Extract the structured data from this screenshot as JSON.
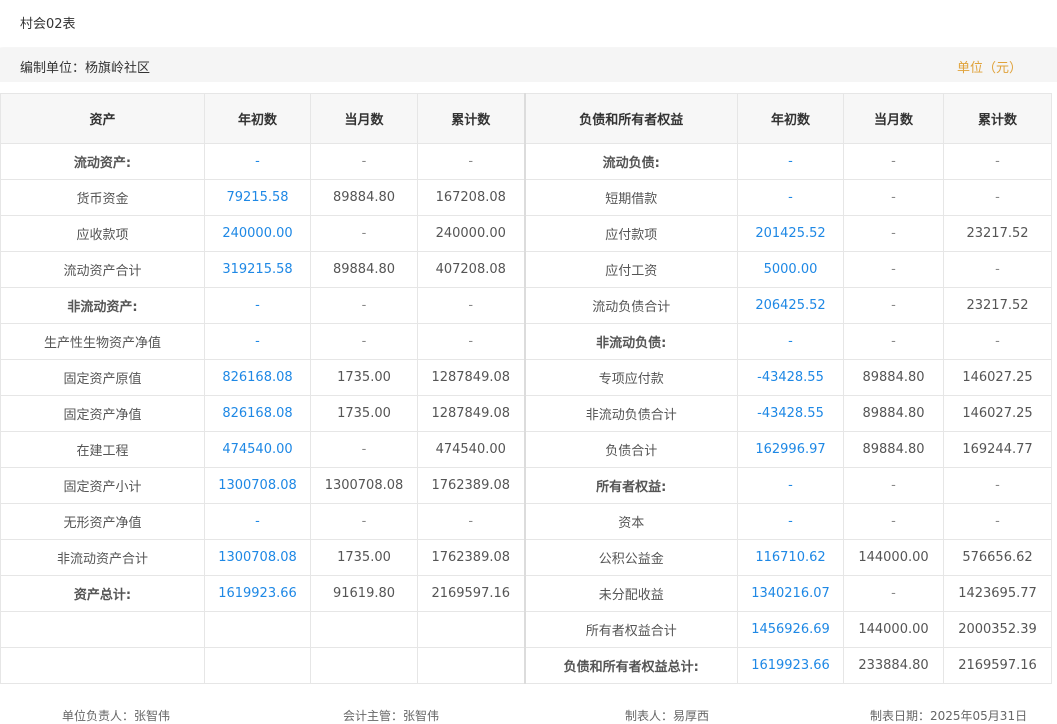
{
  "header": {
    "form_code": "村会02表"
  },
  "meta": {
    "org": "编制单位：杨旗岭社区",
    "unit": "单位（元）"
  },
  "columns": {
    "left": [
      "资产",
      "年初数",
      "当月数",
      "累计数"
    ],
    "right": [
      "负债和所有者权益",
      "年初数",
      "当月数",
      "累计数"
    ]
  },
  "rows": [
    {
      "l": [
        "流动资产:",
        "-",
        "-",
        "-"
      ],
      "r": [
        "流动负债:",
        "-",
        "-",
        "-"
      ],
      "lsub": true,
      "rsub": true
    },
    {
      "l": [
        "货币资金",
        "79215.58",
        "89884.80",
        "167208.08"
      ],
      "r": [
        "短期借款",
        "-",
        "-",
        "-"
      ]
    },
    {
      "l": [
        "应收款项",
        "240000.00",
        "-",
        "240000.00"
      ],
      "r": [
        "应付款项",
        "201425.52",
        "-",
        "23217.52"
      ]
    },
    {
      "l": [
        "流动资产合计",
        "319215.58",
        "89884.80",
        "407208.08"
      ],
      "r": [
        "应付工资",
        "5000.00",
        "-",
        "-"
      ]
    },
    {
      "l": [
        "非流动资产:",
        "-",
        "-",
        "-"
      ],
      "r": [
        "流动负债合计",
        "206425.52",
        "-",
        "23217.52"
      ],
      "lsub": true
    },
    {
      "l": [
        "生产性生物资产净值",
        "-",
        "-",
        "-"
      ],
      "r": [
        "非流动负债:",
        "-",
        "-",
        "-"
      ],
      "rsub": true
    },
    {
      "l": [
        "固定资产原值",
        "826168.08",
        "1735.00",
        "1287849.08"
      ],
      "r": [
        "专项应付款",
        "-43428.55",
        "89884.80",
        "146027.25"
      ]
    },
    {
      "l": [
        "固定资产净值",
        "826168.08",
        "1735.00",
        "1287849.08"
      ],
      "r": [
        "非流动负债合计",
        "-43428.55",
        "89884.80",
        "146027.25"
      ]
    },
    {
      "l": [
        "在建工程",
        "474540.00",
        "-",
        "474540.00"
      ],
      "r": [
        "负债合计",
        "162996.97",
        "89884.80",
        "169244.77"
      ]
    },
    {
      "l": [
        "固定资产小计",
        "1300708.08",
        "1300708.08",
        "1762389.08"
      ],
      "r": [
        "所有者权益:",
        "-",
        "-",
        "-"
      ],
      "rsub": true
    },
    {
      "l": [
        "无形资产净值",
        "-",
        "-",
        "-"
      ],
      "r": [
        "资本",
        "-",
        "-",
        "-"
      ]
    },
    {
      "l": [
        "非流动资产合计",
        "1300708.08",
        "1735.00",
        "1762389.08"
      ],
      "r": [
        "公积公益金",
        "116710.62",
        "144000.00",
        "576656.62"
      ]
    },
    {
      "l": [
        "资产总计:",
        "1619923.66",
        "91619.80",
        "2169597.16"
      ],
      "r": [
        "未分配收益",
        "1340216.07",
        "-",
        "1423695.77"
      ],
      "lsub": true
    },
    {
      "l": [
        "",
        "",
        "",
        ""
      ],
      "r": [
        "所有者权益合计",
        "1456926.69",
        "144000.00",
        "2000352.39"
      ]
    },
    {
      "l": [
        "",
        "",
        "",
        ""
      ],
      "r": [
        "负债和所有者权益总计:",
        "1619923.66",
        "233884.80",
        "2169597.16"
      ],
      "rsub": true
    }
  ],
  "footer": {
    "head": "单位负责人：张智伟",
    "accountant": "会计主管：张智伟",
    "preparer": "制表人：易厚西",
    "date": "制表日期：2025年05月31日"
  },
  "colors": {
    "link": "#1e88e5",
    "unit": "#e0a23a",
    "header_bg": "#f7f7f7"
  }
}
